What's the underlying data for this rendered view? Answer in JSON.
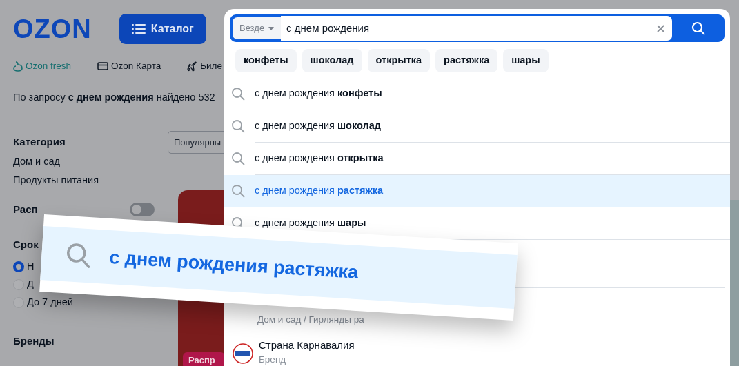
{
  "header": {
    "logo": "OZON",
    "catalog_button": "Каталог"
  },
  "nav_links": [
    {
      "label": "Ozon fresh",
      "kind": "fresh"
    },
    {
      "label": "Ozon Карта",
      "kind": "card"
    },
    {
      "label": "Биле",
      "kind": "plane"
    }
  ],
  "result_summary": "По запросу **с днем рождения** найдено 532",
  "filters": {
    "category_title": "Категория",
    "categories": [
      "Дом и сад",
      "Продукты питания"
    ],
    "toggle": {
      "label": "Расп",
      "on": false
    },
    "delivery_title": "Срок",
    "delivery_options": [
      {
        "label": "Н",
        "selected": true
      },
      {
        "label": "Д",
        "selected": false
      },
      {
        "label": "До 7 дней",
        "selected": false
      }
    ],
    "brands_title": "Бренды"
  },
  "sort_button": "Популярны",
  "product": {
    "badge": "Распр"
  },
  "search": {
    "scope": "Везде",
    "value": "с днем рождения ",
    "chips": [
      "конфеты",
      "шоколад",
      "открытка",
      "растяжка",
      "шары"
    ],
    "suggestions": [
      {
        "text": "с днем рождения **конфеты**",
        "selected": false
      },
      {
        "text": "с днем рождения **шоколад**",
        "selected": false
      },
      {
        "text": "с днем рождения **открытка**",
        "selected": false
      },
      {
        "text": "с днем рождения **растяжка**",
        "selected": true
      },
      {
        "text": "с днем рождения **шары**",
        "selected": false
      }
    ],
    "category_result": {
      "path": "Дом и сад / Гирлянды ра"
    },
    "brand_result": {
      "name": "Страна Карнавалия",
      "type": "Бренд"
    }
  },
  "callout": {
    "text": "с днем рождения растяжка"
  }
}
